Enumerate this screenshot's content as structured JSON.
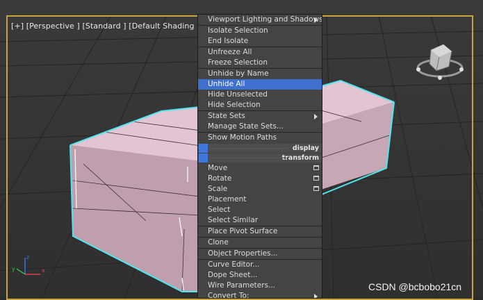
{
  "viewport": {
    "label": "[+] [Perspective ] [Standard ] [Default Shading ]"
  },
  "quad_menu": {
    "top_quadrant": [
      {
        "label": "Viewport Lighting and Shadows",
        "submenu": true
      },
      {
        "label": "Isolate Selection"
      },
      {
        "label": "End Isolate"
      },
      {
        "label": "Unfreeze All"
      },
      {
        "label": "Freeze Selection"
      },
      {
        "label": "Unhide by Name"
      },
      {
        "label": "Unhide All",
        "highlighted": true
      },
      {
        "label": "Hide Unselected"
      },
      {
        "label": "Hide Selection"
      },
      {
        "label": "State Sets",
        "submenu": true
      },
      {
        "label": "Manage State Sets..."
      },
      {
        "label": "Show Motion Paths"
      }
    ],
    "display_title": "display",
    "transform_title": "transform",
    "bottom_quadrant": [
      {
        "label": "Move",
        "options": true
      },
      {
        "label": "Rotate",
        "options": true
      },
      {
        "label": "Scale",
        "options": true
      },
      {
        "label": "Placement"
      },
      {
        "label": "Select"
      },
      {
        "label": "Select Similar"
      },
      {
        "label": "Place Pivot Surface"
      },
      {
        "label": "Clone"
      },
      {
        "label": "Object Properties..."
      },
      {
        "label": "Curve Editor..."
      },
      {
        "label": "Dope Sheet..."
      },
      {
        "label": "Wire Parameters..."
      },
      {
        "label": "Convert To:",
        "submenu": true
      }
    ]
  },
  "watermark": "CSDN @bcbobo21cn",
  "colors": {
    "selection_outline": "#4fe6f0",
    "box_top": "#e3c4d2",
    "box_front": "#bf9fad",
    "highlight": "#3f6fcf",
    "frame": "#c9a43a"
  }
}
